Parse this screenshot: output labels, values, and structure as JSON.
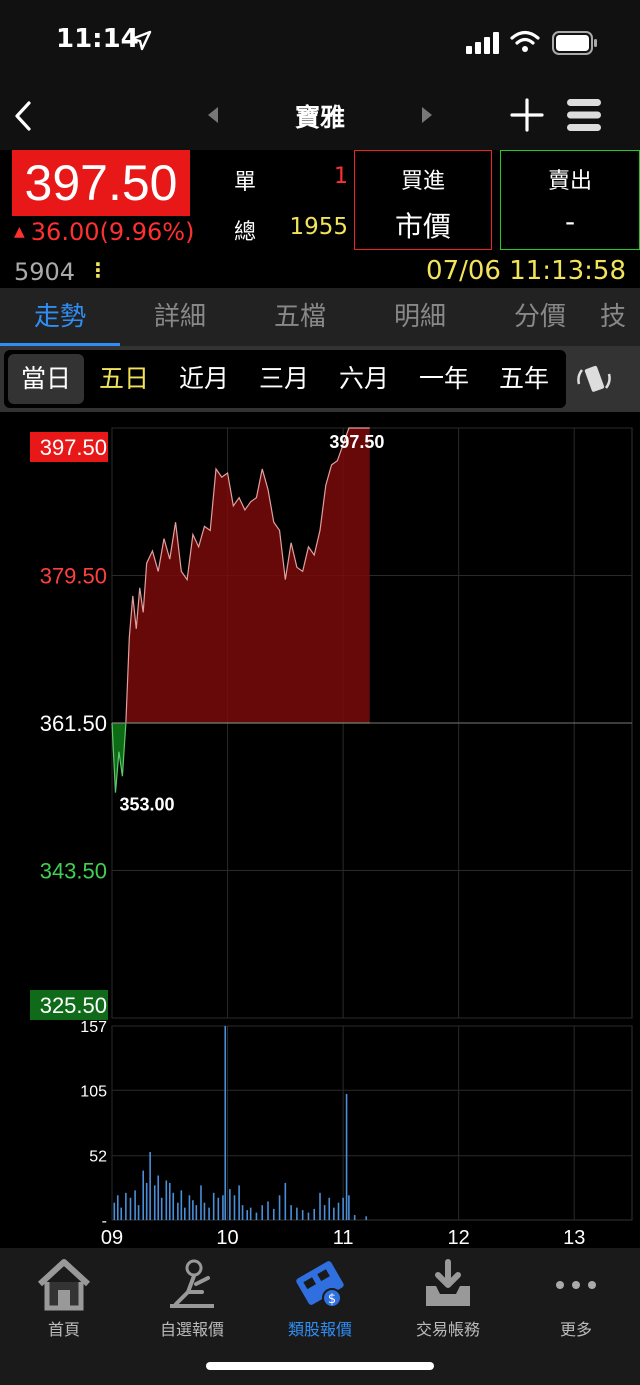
{
  "status_bar": {
    "time": "11:14"
  },
  "nav": {
    "title": "寶雅"
  },
  "quote": {
    "price": "397.50",
    "change": "36.00(9.96%)",
    "single_label": "單",
    "single_value": "1",
    "total_label": "總",
    "total_value": "1955",
    "code": "5904",
    "datetime": "07/06 11:13:58",
    "buy_label": "買進",
    "buy_value": "市價",
    "sell_label": "賣出",
    "sell_value": "-"
  },
  "tabs": [
    "走勢",
    "詳細",
    "五檔",
    "明細",
    "分價",
    "技"
  ],
  "ranges": [
    "當日",
    "五日",
    "近月",
    "三月",
    "六月",
    "一年",
    "五年"
  ],
  "chart_data": {
    "type": "area",
    "y_ticks": [
      "397.50",
      "379.50",
      "361.50",
      "343.50",
      "325.50"
    ],
    "ylim": [
      325.5,
      397.5
    ],
    "reference": 361.5,
    "high_label": "397.50",
    "low_label": "353.00",
    "x_ticks": [
      "09",
      "10",
      "11",
      "12",
      "13"
    ],
    "price_series": [
      {
        "t": 9.0,
        "v": 361.5
      },
      {
        "t": 9.03,
        "v": 353.0
      },
      {
        "t": 9.06,
        "v": 358.0
      },
      {
        "t": 9.09,
        "v": 355.0
      },
      {
        "t": 9.12,
        "v": 361.5
      },
      {
        "t": 9.15,
        "v": 372.0
      },
      {
        "t": 9.18,
        "v": 377.0
      },
      {
        "t": 9.21,
        "v": 373.0
      },
      {
        "t": 9.24,
        "v": 378.0
      },
      {
        "t": 9.27,
        "v": 375.0
      },
      {
        "t": 9.3,
        "v": 381.0
      },
      {
        "t": 9.35,
        "v": 382.5
      },
      {
        "t": 9.4,
        "v": 380.0
      },
      {
        "t": 9.45,
        "v": 384.0
      },
      {
        "t": 9.5,
        "v": 381.5
      },
      {
        "t": 9.55,
        "v": 386.0
      },
      {
        "t": 9.6,
        "v": 380.0
      },
      {
        "t": 9.65,
        "v": 379.0
      },
      {
        "t": 9.7,
        "v": 384.5
      },
      {
        "t": 9.75,
        "v": 383.0
      },
      {
        "t": 9.8,
        "v": 385.5
      },
      {
        "t": 9.85,
        "v": 385.0
      },
      {
        "t": 9.9,
        "v": 392.5
      },
      {
        "t": 9.95,
        "v": 391.5
      },
      {
        "t": 10.0,
        "v": 392.0
      },
      {
        "t": 10.05,
        "v": 388.0
      },
      {
        "t": 10.1,
        "v": 389.0
      },
      {
        "t": 10.15,
        "v": 387.5
      },
      {
        "t": 10.2,
        "v": 388.5
      },
      {
        "t": 10.25,
        "v": 389.0
      },
      {
        "t": 10.3,
        "v": 392.5
      },
      {
        "t": 10.35,
        "v": 390.0
      },
      {
        "t": 10.4,
        "v": 386.0
      },
      {
        "t": 10.45,
        "v": 385.0
      },
      {
        "t": 10.5,
        "v": 379.0
      },
      {
        "t": 10.55,
        "v": 383.5
      },
      {
        "t": 10.6,
        "v": 380.5
      },
      {
        "t": 10.65,
        "v": 380.0
      },
      {
        "t": 10.7,
        "v": 383.0
      },
      {
        "t": 10.75,
        "v": 382.0
      },
      {
        "t": 10.8,
        "v": 385.0
      },
      {
        "t": 10.85,
        "v": 390.5
      },
      {
        "t": 10.9,
        "v": 393.0
      },
      {
        "t": 10.95,
        "v": 393.5
      },
      {
        "t": 11.0,
        "v": 395.5
      },
      {
        "t": 11.05,
        "v": 397.5
      },
      {
        "t": 11.1,
        "v": 397.5
      },
      {
        "t": 11.23,
        "v": 397.5
      }
    ],
    "volume_ticks": [
      "157",
      "105",
      "52",
      "-"
    ],
    "volume_ylim": [
      0,
      157
    ],
    "volume_series": [
      {
        "t": 9.02,
        "v": 14
      },
      {
        "t": 9.05,
        "v": 20
      },
      {
        "t": 9.08,
        "v": 10
      },
      {
        "t": 9.12,
        "v": 22
      },
      {
        "t": 9.16,
        "v": 18
      },
      {
        "t": 9.2,
        "v": 24
      },
      {
        "t": 9.23,
        "v": 12
      },
      {
        "t": 9.27,
        "v": 40
      },
      {
        "t": 9.3,
        "v": 30
      },
      {
        "t": 9.33,
        "v": 55
      },
      {
        "t": 9.37,
        "v": 28
      },
      {
        "t": 9.4,
        "v": 36
      },
      {
        "t": 9.43,
        "v": 18
      },
      {
        "t": 9.47,
        "v": 32
      },
      {
        "t": 9.5,
        "v": 30
      },
      {
        "t": 9.53,
        "v": 22
      },
      {
        "t": 9.57,
        "v": 14
      },
      {
        "t": 9.6,
        "v": 24
      },
      {
        "t": 9.63,
        "v": 10
      },
      {
        "t": 9.67,
        "v": 20
      },
      {
        "t": 9.7,
        "v": 16
      },
      {
        "t": 9.73,
        "v": 12
      },
      {
        "t": 9.77,
        "v": 28
      },
      {
        "t": 9.8,
        "v": 14
      },
      {
        "t": 9.84,
        "v": 10
      },
      {
        "t": 9.88,
        "v": 22
      },
      {
        "t": 9.92,
        "v": 18
      },
      {
        "t": 9.96,
        "v": 20
      },
      {
        "t": 9.98,
        "v": 157
      },
      {
        "t": 10.02,
        "v": 25
      },
      {
        "t": 10.06,
        "v": 20
      },
      {
        "t": 10.1,
        "v": 28
      },
      {
        "t": 10.13,
        "v": 12
      },
      {
        "t": 10.17,
        "v": 8
      },
      {
        "t": 10.2,
        "v": 10
      },
      {
        "t": 10.25,
        "v": 6
      },
      {
        "t": 10.3,
        "v": 12
      },
      {
        "t": 10.35,
        "v": 15
      },
      {
        "t": 10.4,
        "v": 9
      },
      {
        "t": 10.45,
        "v": 20
      },
      {
        "t": 10.5,
        "v": 30
      },
      {
        "t": 10.55,
        "v": 12
      },
      {
        "t": 10.6,
        "v": 10
      },
      {
        "t": 10.65,
        "v": 8
      },
      {
        "t": 10.7,
        "v": 6
      },
      {
        "t": 10.75,
        "v": 9
      },
      {
        "t": 10.8,
        "v": 22
      },
      {
        "t": 10.84,
        "v": 12
      },
      {
        "t": 10.88,
        "v": 18
      },
      {
        "t": 10.92,
        "v": 10
      },
      {
        "t": 10.96,
        "v": 14
      },
      {
        "t": 11.0,
        "v": 18
      },
      {
        "t": 11.03,
        "v": 102
      },
      {
        "t": 11.05,
        "v": 20
      },
      {
        "t": 11.1,
        "v": 4
      },
      {
        "t": 11.2,
        "v": 3
      }
    ]
  },
  "bottom_nav": [
    {
      "label": "首頁"
    },
    {
      "label": "自選報價"
    },
    {
      "label": "類股報價"
    },
    {
      "label": "交易帳務"
    },
    {
      "label": "更多"
    }
  ],
  "colors": {
    "up": "#e81818",
    "down": "#1aa31a",
    "accent": "#2f8ef5",
    "highlight_yellow": "#f2e35a"
  }
}
